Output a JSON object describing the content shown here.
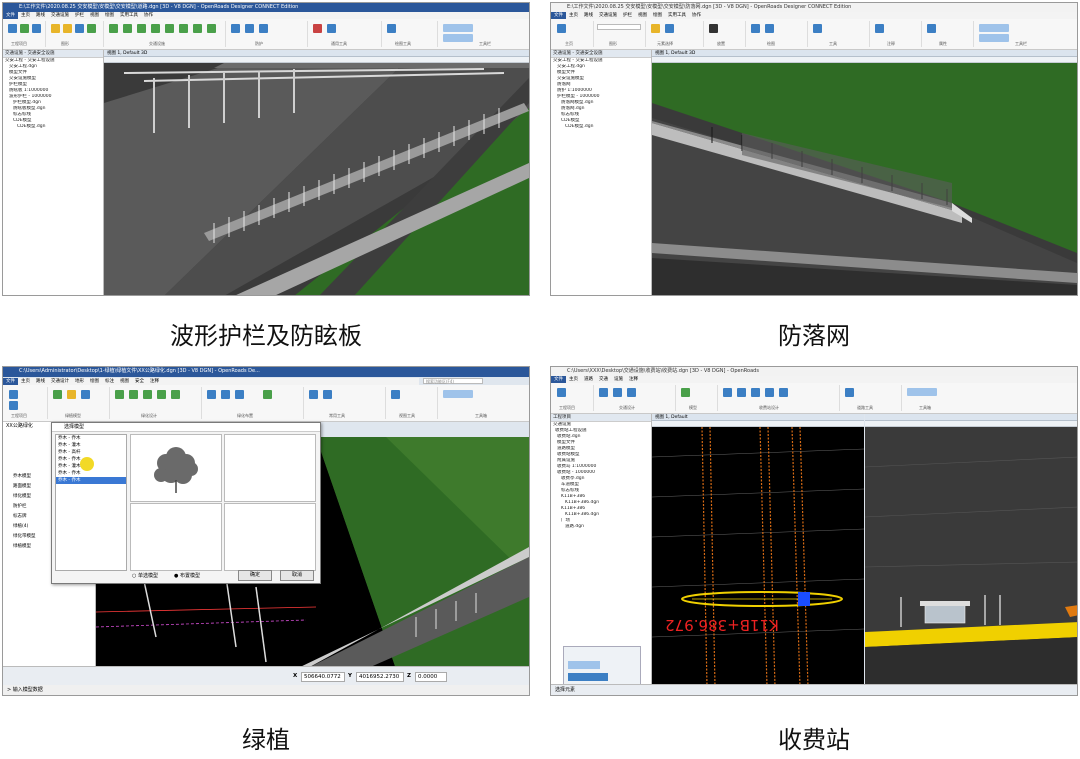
{
  "captions": [
    "波形护栏及防眩板",
    "防落网",
    "绿植",
    "收费站"
  ],
  "panels": [
    {
      "title_left": "CivilStationDesigner",
      "title_center": "E:\\工作文件\\2020.08.25 交安模型\\安模型\\交安模型\\道路.dgn [3D - V8 DGN] - OpenRoads Designer CONNECT Edition",
      "tabs": [
        "文件",
        "主页",
        "路线",
        "交通设施",
        "护栏",
        "视图",
        "绘图",
        "实用工具",
        "协作"
      ],
      "groups": [
        "工程项目",
        "图形",
        "交通设施",
        "防护",
        "通用工具",
        "绘图工具",
        "工具栏"
      ],
      "tree_header": "交通设施 - 交通安全设施",
      "tree_items": [
        "交安工程 - 交安工程设施",
        "交安工程.dgn",
        "模型文件",
        "交安设施模型",
        "护栏模型",
        "防眩板 1:1000000",
        "波形护栏 - 1000000",
        "护栏模型.dgn",
        "防眩板模型.dgn",
        "标志标线",
        "CDE模型",
        "CDE模型.dgn"
      ],
      "view_title": "视图 1, Default 3D"
    },
    {
      "title_left": "CivilStationDesigner",
      "title_center": "E:\\工作文件\\2020.08.25 交安模型\\安模型\\交安模型\\防落网.dgn [3D - V8 DGN] - OpenRoads Designer CONNECT Edition",
      "tabs": [
        "文件",
        "主页",
        "路线",
        "交通设施",
        "护栏",
        "视图",
        "绘图",
        "实用工具",
        "协作"
      ],
      "groups": [
        "主页",
        "图形",
        "元素选择",
        "放置",
        "绘图",
        "工具",
        "注释",
        "属性",
        "工具栏"
      ],
      "tree_header": "交通设施 - 交通安全设施",
      "tree_items": [
        "交安工程 - 交安工程设施",
        "交安工程.dgn",
        "模型文件",
        "交安设施模型",
        "防落网",
        "防护 1:1000000",
        "护栏模型 - 1000000",
        "防落网模型.dgn",
        "防落网.dgn",
        "标志标线",
        "CDE模型",
        "CDE模型.dgn"
      ],
      "view_title": "视图 1, Default 3D"
    },
    {
      "title_left": "CivilStationDesigner",
      "title_center": "C:\\Users\\Administrator\\Desktop\\1-绿植\\绿植文件\\XX公路绿化.dgn [3D - V8 DGN] - OpenRoads De...",
      "search_placeholder": "搜索功能区(F4)",
      "tabs": [
        "文件",
        "主页",
        "路线",
        "交通设计",
        "地形",
        "绘图",
        "标注",
        "视图",
        "安全",
        "注释"
      ],
      "groups": [
        "工程项目",
        "绿植模型",
        "绿化设计",
        "绿化布置",
        "常用工具",
        "视图工具",
        "工具箱"
      ],
      "dialog_title": "选择模型",
      "dialog_tree": [
        "乔木 - 乔木",
        "乔木 - 灌木",
        "乔木 - 高杆",
        "乔木 - 乔木",
        "乔木 - 灌木",
        "乔木 - 乔木",
        "乔木 - 乔木"
      ],
      "dialog_radio_1": "单选模型",
      "dialog_radio_2": "布置模型",
      "dialog_ok": "确定",
      "dialog_cancel": "取消",
      "left_panel_items": [
        "XX公路绿化",
        "乔木模型",
        "路面模型",
        "绿化模型",
        "防护栏",
        "标志牌",
        "绿植(4)",
        "绿化带模型",
        "绿植模型"
      ],
      "status_x_label": "X",
      "status_x": "506640.0772",
      "status_y_label": "Y",
      "status_y": "4016952.2730",
      "status_z_label": "Z",
      "status_z": "0.0000",
      "status_prompt": "> 输入模型数据"
    },
    {
      "title_left": "CivilStationDesigner",
      "title_center": "C:\\Users\\XXX\\Desktop\\交通设施\\收费站\\收费站.dgn [3D - V8 DGN] - OpenRoads",
      "tabs": [
        "文件",
        "主页",
        "道路",
        "交通",
        "设施",
        "注释"
      ],
      "groups": [
        "工程项目",
        "交通设计",
        "模型",
        "收费站设计",
        "道路工具",
        "工具箱"
      ],
      "tree_header": "工程项目",
      "tree_items": [
        "交通设施",
        "收费站工程设施",
        "收费站.dgn",
        "模型文件",
        "道路模型",
        "收费站模型",
        "附属设施",
        "收费岛 1:1000000",
        "收费站 - 1000000",
        "收费亭.dgn",
        "车道模型",
        "标志标线",
        "K11B+386",
        "K11B+386.dgn",
        "K11B+386",
        "K11B+386.dgn",
        "广场",
        "道路.dgn"
      ],
      "view_title": "视图 1, Default",
      "station_label": "K11B+386.972",
      "status_prompt": "选择元素"
    }
  ],
  "colors": {
    "ribbon_blue": "#2b579a",
    "grass": "#2f6b24",
    "road": "#5d5d5d",
    "cad_black": "#000000",
    "toll_yellow": "#f0d000"
  }
}
